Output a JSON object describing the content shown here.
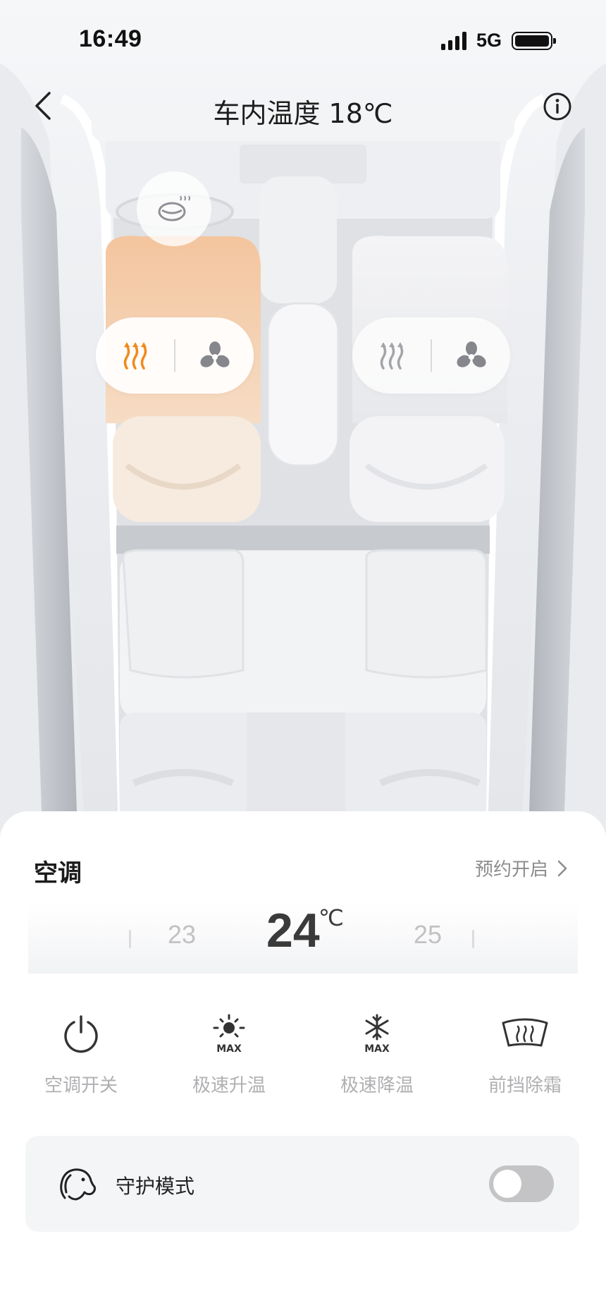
{
  "status_bar": {
    "time": "16:49",
    "network": "5G"
  },
  "nav": {
    "title": "车内温度 18℃",
    "back_icon": "chevron-left-icon",
    "info_icon": "info-icon"
  },
  "car": {
    "steering_wheel_heat": {
      "icon": "steering-wheel-heat-icon",
      "active": false
    },
    "driver_seat": {
      "heat_icon": "seat-heat-icon",
      "heat_active": true,
      "vent_icon": "fan-icon",
      "vent_active": false,
      "heat_color": "#f08a1c"
    },
    "passenger_seat": {
      "heat_icon": "seat-heat-icon",
      "heat_active": false,
      "vent_icon": "fan-icon",
      "vent_active": false
    }
  },
  "ac": {
    "title": "空调",
    "schedule_label": "预约开启",
    "temperature": {
      "current": "24",
      "unit": "℃",
      "prev": "23",
      "next": "25"
    },
    "functions": [
      {
        "icon": "power-icon",
        "label": "空调开关"
      },
      {
        "icon": "sun-max-icon",
        "label": "极速升温",
        "badge": "MAX"
      },
      {
        "icon": "snowflake-max-icon",
        "label": "极速降温",
        "badge": "MAX"
      },
      {
        "icon": "windshield-defrost-icon",
        "label": "前挡除霜"
      }
    ],
    "guard_mode": {
      "icon": "dog-icon",
      "label": "守护模式",
      "enabled": false
    }
  },
  "colors": {
    "heat_active": "#f08a1c",
    "icon_default": "#333333",
    "label_muted": "#b0b0b3"
  }
}
